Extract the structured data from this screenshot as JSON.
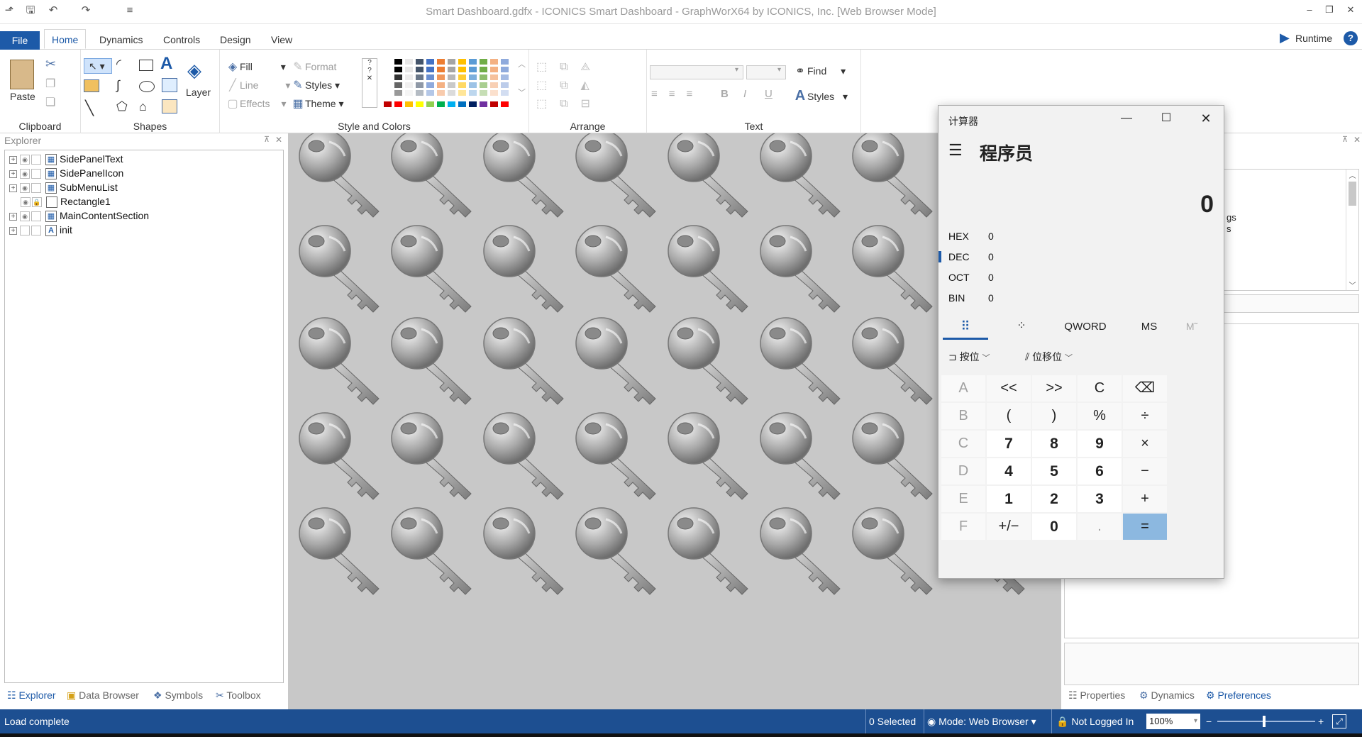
{
  "window_title": "Smart Dashboard.gdfx - ICONICS Smart Dashboard - GraphWorX64 by ICONICS, Inc. [Web Browser Mode]",
  "tabs": [
    "File",
    "Home",
    "Dynamics",
    "Controls",
    "Design",
    "View"
  ],
  "runtime_label": "Runtime",
  "ribbon": {
    "clipboard": {
      "paste": "Paste",
      "label": "Clipboard"
    },
    "shapes": {
      "layer": "Layer",
      "label": "Shapes"
    },
    "style": {
      "fill": "Fill",
      "line": "Line",
      "effects": "Effects",
      "format": "Format",
      "styles": "Styles",
      "theme": "Theme",
      "label": "Style and Colors"
    },
    "arrange": {
      "label": "Arrange"
    },
    "text": {
      "find": "Find",
      "styles": "Styles",
      "bold": "B",
      "italic": "I",
      "underline": "U",
      "label": "Text"
    }
  },
  "explorer": {
    "header": "Explorer",
    "items": [
      {
        "label": "SidePanelText",
        "icon": "grid"
      },
      {
        "label": "SidePanelIcon",
        "icon": "grid"
      },
      {
        "label": "SubMenuList",
        "icon": "grid"
      },
      {
        "label": "Rectangle1",
        "icon": "rect"
      },
      {
        "label": "MainContentSection",
        "icon": "grid"
      },
      {
        "label": "init",
        "icon": "text"
      }
    ],
    "bottom_tabs": [
      "Explorer",
      "Data Browser",
      "Symbols",
      "Toolbox"
    ]
  },
  "right_panel": {
    "fragment1": "gs",
    "fragment2": "s",
    "bottom_tabs": [
      "Properties",
      "Dynamics",
      "Preferences"
    ]
  },
  "calculator": {
    "title": "计算器",
    "mode": "程序员",
    "display": "0",
    "radix": [
      {
        "name": "HEX",
        "value": "0"
      },
      {
        "name": "DEC",
        "value": "0"
      },
      {
        "name": "OCT",
        "value": "0"
      },
      {
        "name": "BIN",
        "value": "0"
      }
    ],
    "word_size": "QWORD",
    "ms": "MS",
    "mplus": "M˜",
    "bitwise": "按位",
    "bitshift": "位移位",
    "keys": [
      [
        "A",
        "<<",
        ">>",
        "C",
        "⌫"
      ],
      [
        "B",
        "(",
        ")",
        "%",
        "÷"
      ],
      [
        "C",
        "7",
        "8",
        "9",
        "×"
      ],
      [
        "D",
        "4",
        "5",
        "6",
        "−"
      ],
      [
        "E",
        "1",
        "2",
        "3",
        "+"
      ],
      [
        "F",
        "+/−",
        "0",
        ".",
        "="
      ]
    ]
  },
  "status": {
    "left": "Load complete",
    "selected": "0 Selected",
    "mode": "Mode: Web Browser",
    "login": "Not Logged In",
    "zoom": "100%"
  },
  "colors": {
    "accent": "#1d5aa8",
    "status_bg": "#1d4f91",
    "canvas_bg": "#c8c8c8",
    "equals_bg": "#8cb8e0"
  }
}
